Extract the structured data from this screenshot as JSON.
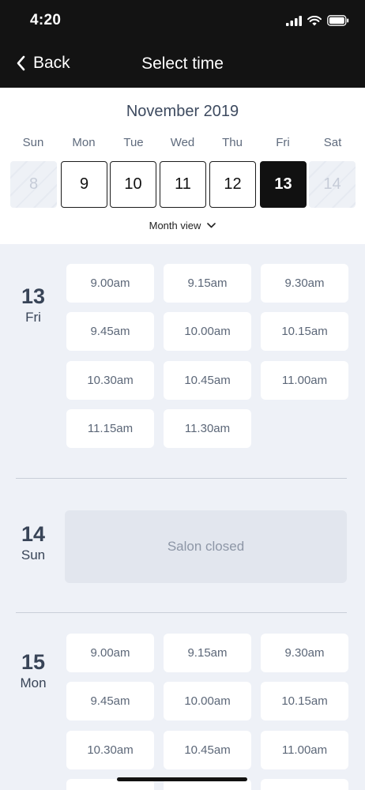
{
  "status": {
    "time": "4:20"
  },
  "nav": {
    "back_label": "Back",
    "title": "Select time"
  },
  "calendar": {
    "month": "November 2019",
    "weekdays": [
      "Sun",
      "Mon",
      "Tue",
      "Wed",
      "Thu",
      "Fri",
      "Sat"
    ],
    "days": [
      "8",
      "9",
      "10",
      "11",
      "12",
      "13",
      "14"
    ],
    "selected_day": "13",
    "disabled_days": [
      "8",
      "14"
    ],
    "month_view_label": "Month view"
  },
  "schedule": [
    {
      "day_number": "13",
      "day_name": "Fri",
      "slots": [
        "9.00am",
        "9.15am",
        "9.30am",
        "9.45am",
        "10.00am",
        "10.15am",
        "10.30am",
        "10.45am",
        "11.00am",
        "11.15am",
        "11.30am"
      ]
    },
    {
      "day_number": "14",
      "day_name": "Sun",
      "closed_text": "Salon closed"
    },
    {
      "day_number": "15",
      "day_name": "Mon",
      "slots": [
        "9.00am",
        "9.15am",
        "9.30am",
        "9.45am",
        "10.00am",
        "10.15am",
        "10.30am",
        "10.45am",
        "11.00am"
      ]
    }
  ],
  "colors": {
    "selected": "#111111",
    "background": "#eef1f7",
    "slot_text": "#5c6778"
  }
}
